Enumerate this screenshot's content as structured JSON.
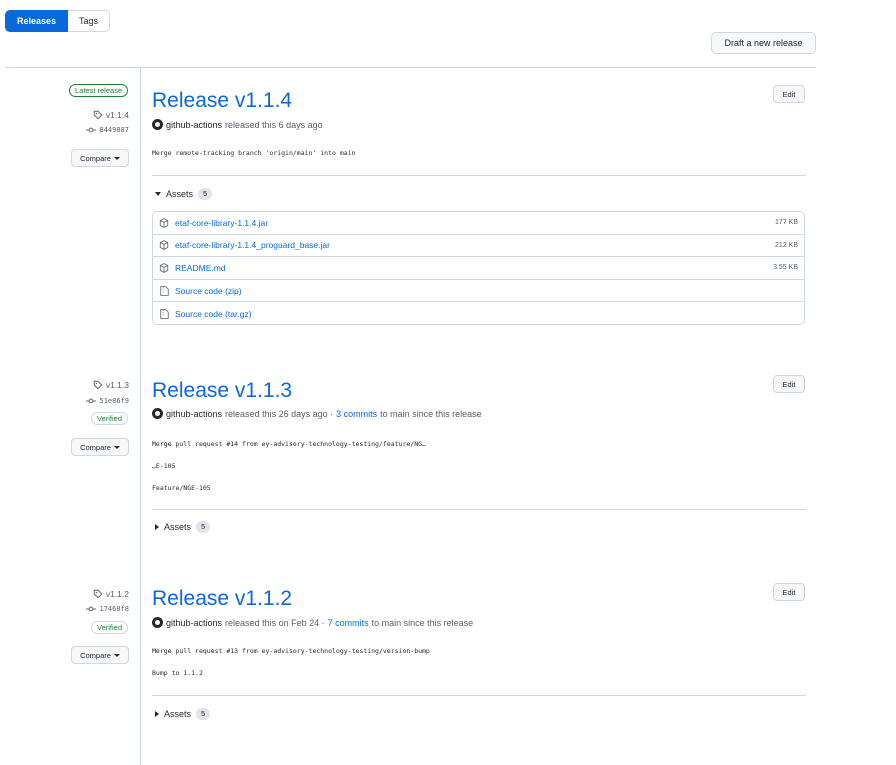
{
  "tabs": {
    "releases": "Releases",
    "tags": "Tags"
  },
  "draft_button": "Draft a new release",
  "labels": {
    "latest_release": "Latest release",
    "compare": "Compare",
    "edit": "Edit",
    "verified": "Verified",
    "assets": "Assets",
    "to_main": "to main since this release"
  },
  "releases": [
    {
      "tag": "v1.1.4",
      "sha": "8449807",
      "title": "Release v1.1.4",
      "author": "github-actions",
      "released": "released this 6 days ago",
      "body": [
        "Merge remote-tracking branch 'origin/main' into main"
      ],
      "assets_count": "5",
      "assets": [
        {
          "name": "etaf-core-library-1.1.4.jar",
          "size": "177 KB",
          "icon": "package-icon"
        },
        {
          "name": "etaf-core-library-1.1.4_proguard_base.jar",
          "size": "212 KB",
          "icon": "package-icon"
        },
        {
          "name": "README.md",
          "size": "3.55 KB",
          "icon": "package-icon"
        },
        {
          "name": "Source code (zip)",
          "size": "",
          "icon": "file-zip-icon"
        },
        {
          "name": "Source code (tar.gz)",
          "size": "",
          "icon": "file-zip-icon"
        }
      ]
    },
    {
      "tag": "v1.1.3",
      "sha": "51e86f9",
      "title": "Release v1.1.3",
      "author": "github-actions",
      "released": "released this 26 days ago ·",
      "commits": "3 commits",
      "body": [
        "Merge pull request #14 from ey-advisory-technology-testing/feature/NG…",
        "…E-105",
        "Feature/NGE-105"
      ],
      "assets_count": "5"
    },
    {
      "tag": "v1.1.2",
      "sha": "17468f8",
      "title": "Release v1.1.2",
      "author": "github-actions",
      "released": "released this on Feb 24 ·",
      "commits": "7 commits",
      "body": [
        "Merge pull request #13 from ey-advisory-technology-testing/version-bump",
        "Bump to 1.1.2"
      ],
      "assets_count": "5"
    }
  ],
  "colors": {
    "accent": "#0969da",
    "success": "#1a7f37",
    "border": "#d0d7de",
    "muted": "#57606a"
  }
}
